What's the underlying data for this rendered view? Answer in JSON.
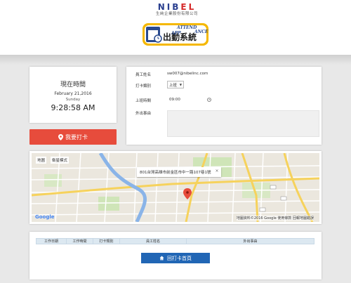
{
  "brand": {
    "logo_left": "NIB",
    "logo_right": "EL",
    "subtitle": "生純企業股份有限公司",
    "app_logo_kanji": "出勤系統",
    "app_logo_word1": "ATTEND",
    "app_logo_word2": "ANCE",
    "app_logo_word3": "APP"
  },
  "clock": {
    "title": "現在時間",
    "date": "February 21,2016",
    "weekday": "Sunday",
    "time": "9:28:58 AM"
  },
  "punch_button": {
    "label": "我要打卡"
  },
  "form": {
    "employee_label": "員工姓名",
    "employee_value": "sw007@nibelinc.com",
    "category_label": "打卡類別",
    "category_value": "上班",
    "work_time_label": "上班時間",
    "work_time_value": "09:00",
    "outing_label": "外出事由",
    "outing_value": ""
  },
  "map": {
    "type_map": "地圖",
    "type_satellite": "衛星模式",
    "info_text": "801台灣高雄市前金區市中一路107巷1號",
    "info_close": "×",
    "google": "Google",
    "attribution": "地圖資料©2016 Google  使用條款  回報地圖錯誤"
  },
  "table": {
    "headers": [
      "工作日期",
      "工作時間",
      "打卡類別",
      "員工姓名",
      "外出事由"
    ]
  },
  "home_button": {
    "label": "回打卡首頁"
  },
  "colors": {
    "punch": "#e74c3c",
    "home": "#2166b5",
    "table_header": "#dce8f1"
  }
}
